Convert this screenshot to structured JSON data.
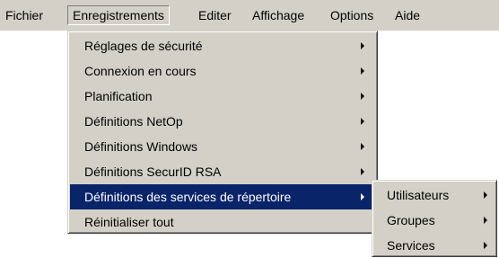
{
  "menubar": {
    "items": [
      {
        "label": "Fichier"
      },
      {
        "label": "Enregistrements"
      },
      {
        "label": "Editer"
      },
      {
        "label": "Affichage"
      },
      {
        "label": "Options"
      },
      {
        "label": "Aide"
      }
    ]
  },
  "dropdown": {
    "items": [
      {
        "label": "Réglages de sécurité",
        "has_submenu": true
      },
      {
        "label": "Connexion en cours",
        "has_submenu": true
      },
      {
        "label": "Planification",
        "has_submenu": true
      },
      {
        "label": "Définitions NetOp",
        "has_submenu": true
      },
      {
        "label": "Définitions Windows",
        "has_submenu": true
      },
      {
        "label": "Définitions SecurID RSA",
        "has_submenu": true
      },
      {
        "label": "Définitions des services de répertoire",
        "has_submenu": true,
        "selected": true
      },
      {
        "label": "Réinitialiser tout",
        "has_submenu": false
      }
    ]
  },
  "submenu": {
    "items": [
      {
        "label": "Utilisateurs",
        "has_submenu": true
      },
      {
        "label": "Groupes",
        "has_submenu": true
      },
      {
        "label": "Services",
        "has_submenu": true
      }
    ]
  },
  "colors": {
    "menu_face": "#d4d0c8",
    "highlight": "#0a246a"
  }
}
